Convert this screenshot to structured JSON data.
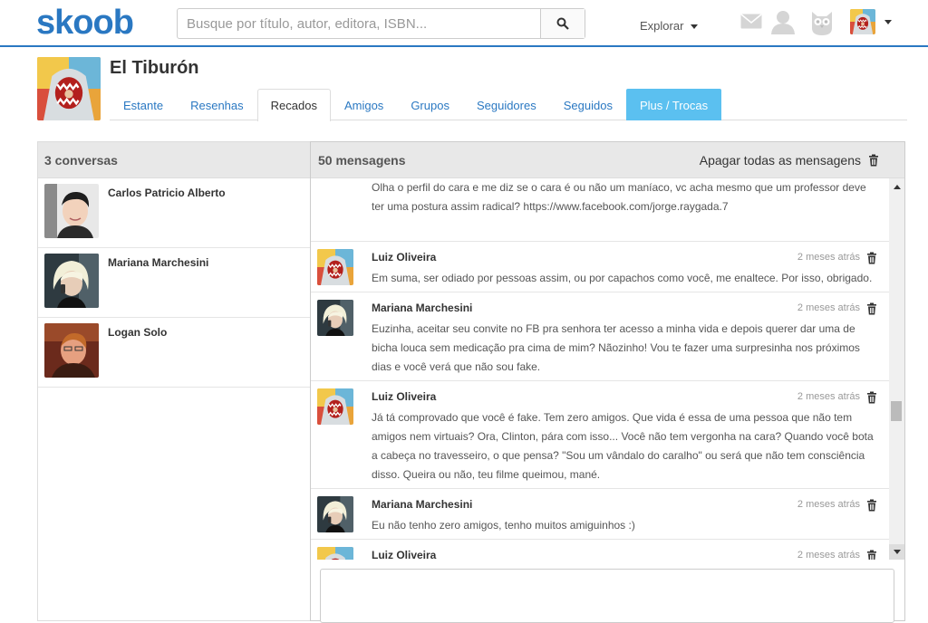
{
  "header": {
    "logo": "skoob",
    "search_placeholder": "Busque por título, autor, editora, ISBN...",
    "explore_label": "Explorar",
    "accent": "#2a78c2"
  },
  "profile": {
    "name": "El Tiburón",
    "tabs": [
      {
        "label": "Estante"
      },
      {
        "label": "Resenhas"
      },
      {
        "label": "Recados",
        "active": true
      },
      {
        "label": "Amigos"
      },
      {
        "label": "Grupos"
      },
      {
        "label": "Seguidores"
      },
      {
        "label": "Seguidos"
      },
      {
        "label": "Plus / Trocas"
      }
    ]
  },
  "conversations": {
    "header": "3 conversas",
    "items": [
      {
        "name": "Carlos Patricio Alberto"
      },
      {
        "name": "Mariana Marchesini"
      },
      {
        "name": "Logan Solo"
      }
    ]
  },
  "messages": {
    "header": "50 mensagens",
    "clear_all": "Apagar todas as mensagens",
    "items": [
      {
        "author": "",
        "time": "",
        "text": "Olha o perfil do cara e me diz se o cara é ou não um maníaco, vc acha mesmo que um professor deve ter uma postura assim radical? https://www.facebook.com/jorge.raygada.7"
      },
      {
        "author": "Luiz Oliveira",
        "time": "2 meses atrás",
        "text": "Em suma, ser odiado por pessoas assim, ou por capachos como você, me enaltece. Por isso, obrigado."
      },
      {
        "author": "Mariana Marchesini",
        "time": "2 meses atrás",
        "text": "Euzinha, aceitar seu convite no FB pra senhora ter acesso a minha vida e depois querer dar uma de bicha louca sem medicação pra cima de mim? Nãozinho! Vou te fazer uma surpresinha nos próximos dias e você verá que não sou fake."
      },
      {
        "author": "Luiz Oliveira",
        "time": "2 meses atrás",
        "text": "Já tá comprovado que você é fake. Tem zero amigos. Que vida é essa de uma pessoa que não tem amigos nem virtuais? Ora, Clinton, pára com isso... Você não tem vergonha na cara? Quando você bota a cabeça no travesseiro, o que pensa? \"Sou um vândalo do caralho\" ou será que não tem consciência disso. Queira ou não, teu filme queimou, mané."
      },
      {
        "author": "Mariana Marchesini",
        "time": "2 meses atrás",
        "text": "Eu não tenho zero amigos, tenho muitos amiguinhos :)"
      },
      {
        "author": "Luiz Oliveira",
        "time": "2 meses atrás",
        "text": ""
      }
    ]
  }
}
